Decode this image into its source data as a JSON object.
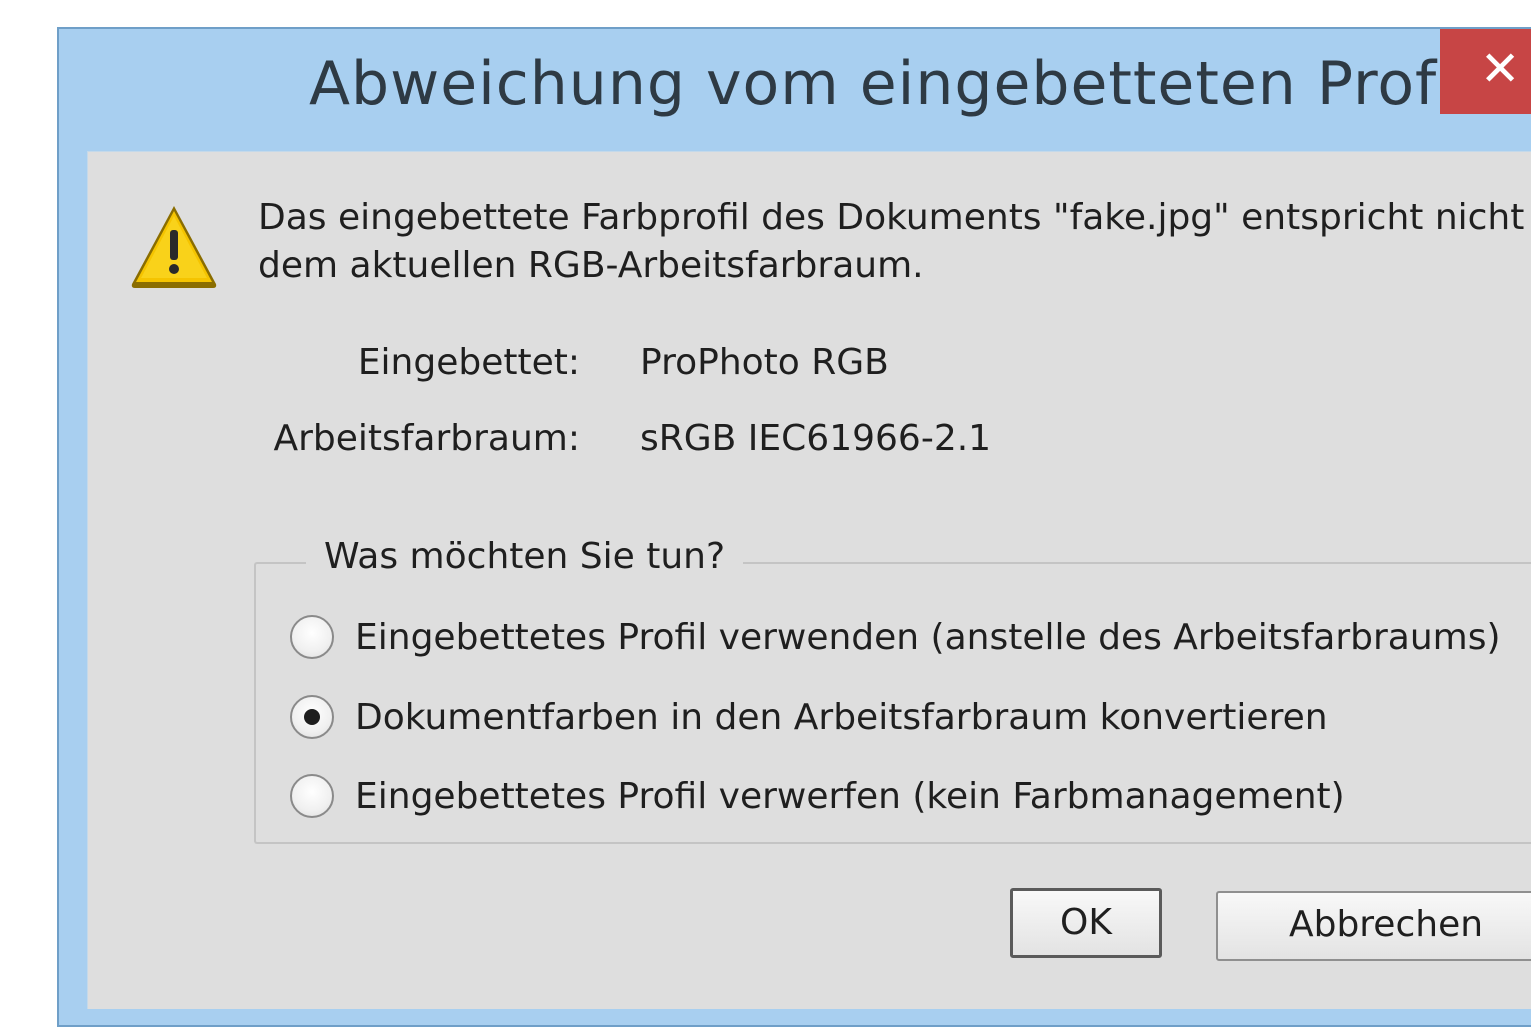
{
  "window": {
    "title": "Abweichung vom eingebetteten Profil",
    "close_label": "✕"
  },
  "message": {
    "line1": "Das eingebettete Farbprofil des Dokuments \"fake.jpg\" entspricht nicht",
    "line2": "dem aktuellen RGB-Arbeitsfarbraum.",
    "icon": "warning-icon"
  },
  "profiles": {
    "embedded_label": "Eingebettet:",
    "embedded_value": "ProPhoto RGB",
    "working_label": "Arbeitsfarbraum:",
    "working_value": "sRGB IEC61966-2.1"
  },
  "options": {
    "legend": "Was möchten Sie tun?",
    "items": [
      {
        "label": "Eingebettetes Profil verwenden (anstelle des Arbeitsfarbraums)",
        "checked": false
      },
      {
        "label": "Dokumentfarben in den Arbeitsfarbraum konvertieren",
        "checked": true
      },
      {
        "label": "Eingebettetes Profil verwerfen (kein Farbmanagement)",
        "checked": false
      }
    ]
  },
  "buttons": {
    "ok": "OK",
    "cancel": "Abbrechen"
  },
  "colors": {
    "titlebar": "#a8cff0",
    "close": "#c74545",
    "client": "#dedede",
    "warning_fill": "#f5c400"
  }
}
